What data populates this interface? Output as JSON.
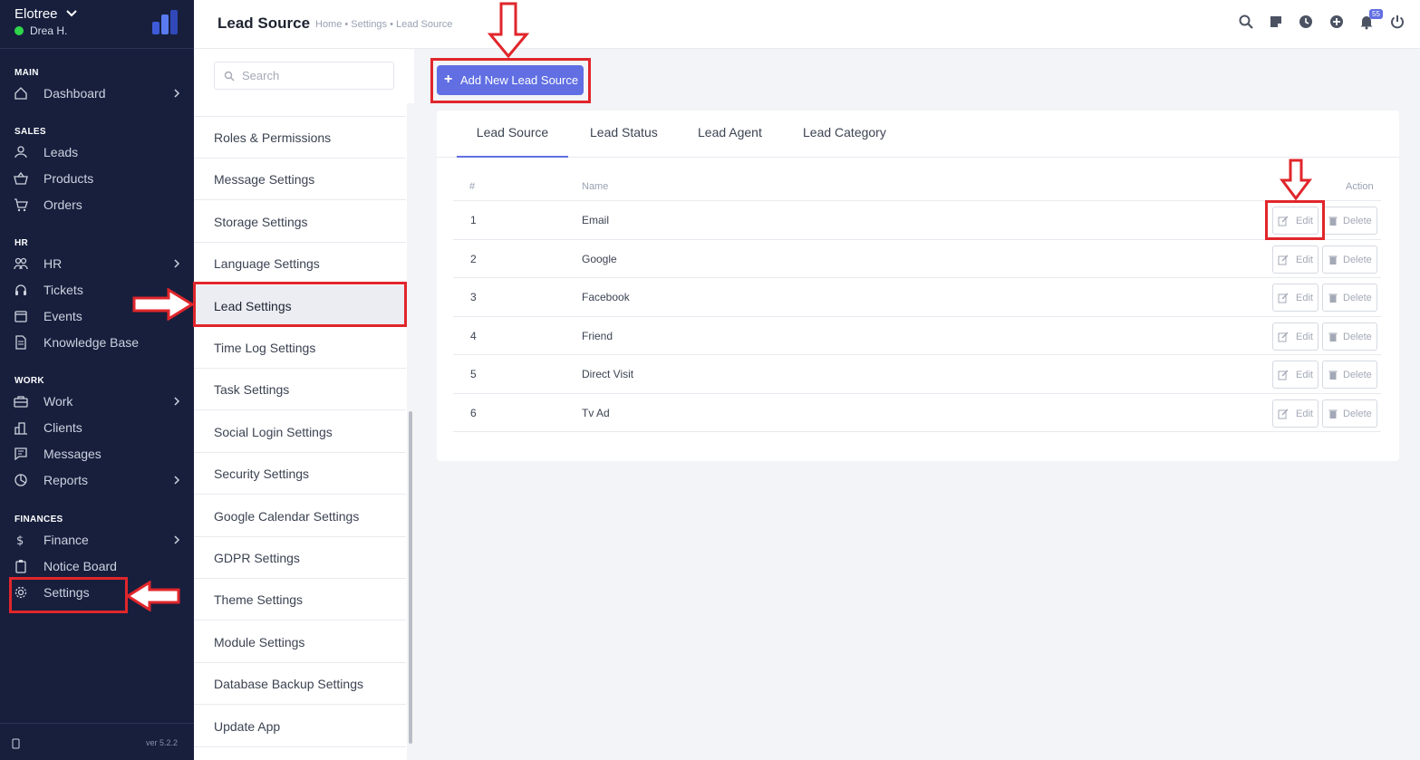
{
  "sidebar": {
    "company": "Elotree",
    "user": "Drea H.",
    "version": "ver 5.2.2",
    "sections": [
      {
        "title": "MAIN",
        "items": [
          {
            "label": "Dashboard",
            "icon": "home-icon",
            "arrow": true
          }
        ]
      },
      {
        "title": "SALES",
        "items": [
          {
            "label": "Leads",
            "icon": "user-icon"
          },
          {
            "label": "Products",
            "icon": "basket-icon"
          },
          {
            "label": "Orders",
            "icon": "cart-icon"
          }
        ]
      },
      {
        "title": "HR",
        "items": [
          {
            "label": "HR",
            "icon": "people-icon",
            "arrow": true
          },
          {
            "label": "Tickets",
            "icon": "headset-icon"
          },
          {
            "label": "Events",
            "icon": "calendar-icon"
          },
          {
            "label": "Knowledge Base",
            "icon": "book-icon"
          }
        ]
      },
      {
        "title": "WORK",
        "items": [
          {
            "label": "Work",
            "icon": "briefcase-icon",
            "arrow": true
          },
          {
            "label": "Clients",
            "icon": "building-icon"
          },
          {
            "label": "Messages",
            "icon": "message-icon"
          },
          {
            "label": "Reports",
            "icon": "pie-chart-icon",
            "arrow": true
          }
        ]
      },
      {
        "title": "FINANCES",
        "items": [
          {
            "label": "Finance",
            "icon": "dollar-icon",
            "arrow": true
          },
          {
            "label": "Notice Board",
            "icon": "clipboard-icon"
          },
          {
            "label": "Settings",
            "icon": "gear-icon"
          }
        ]
      }
    ]
  },
  "header": {
    "title": "Lead Source",
    "breadcrumb": "Home • Settings • Lead Source",
    "notification_count": "55",
    "icons": [
      "search-icon",
      "sticky-note-icon",
      "clock-icon",
      "plus-circle-icon",
      "bell-icon",
      "power-icon"
    ]
  },
  "settings_menu": {
    "search_placeholder": "Search",
    "items": [
      "Roles & Permissions",
      "Message Settings",
      "Storage Settings",
      "Language Settings",
      "Lead Settings",
      "Time Log Settings",
      "Task Settings",
      "Social Login Settings",
      "Security Settings",
      "Google Calendar Settings",
      "GDPR Settings",
      "Theme Settings",
      "Module Settings",
      "Database Backup Settings",
      "Update App"
    ],
    "active": "Lead Settings"
  },
  "main": {
    "add_button": "Add New Lead Source",
    "tabs": [
      "Lead Source",
      "Lead Status",
      "Lead Agent",
      "Lead Category"
    ],
    "active_tab": "Lead Source",
    "table": {
      "headers": [
        "#",
        "Name",
        "Action"
      ],
      "rows": [
        {
          "num": "1",
          "name": "Email"
        },
        {
          "num": "2",
          "name": "Google"
        },
        {
          "num": "3",
          "name": "Facebook"
        },
        {
          "num": "4",
          "name": "Friend"
        },
        {
          "num": "5",
          "name": "Direct Visit"
        },
        {
          "num": "6",
          "name": "Tv Ad"
        }
      ],
      "edit_label": "Edit",
      "delete_label": "Delete"
    }
  },
  "colors": {
    "sidebar_bg": "#171f3d",
    "accent": "#616fe3",
    "annotation_red": "#e0262b",
    "status_online": "#2fd64a"
  }
}
